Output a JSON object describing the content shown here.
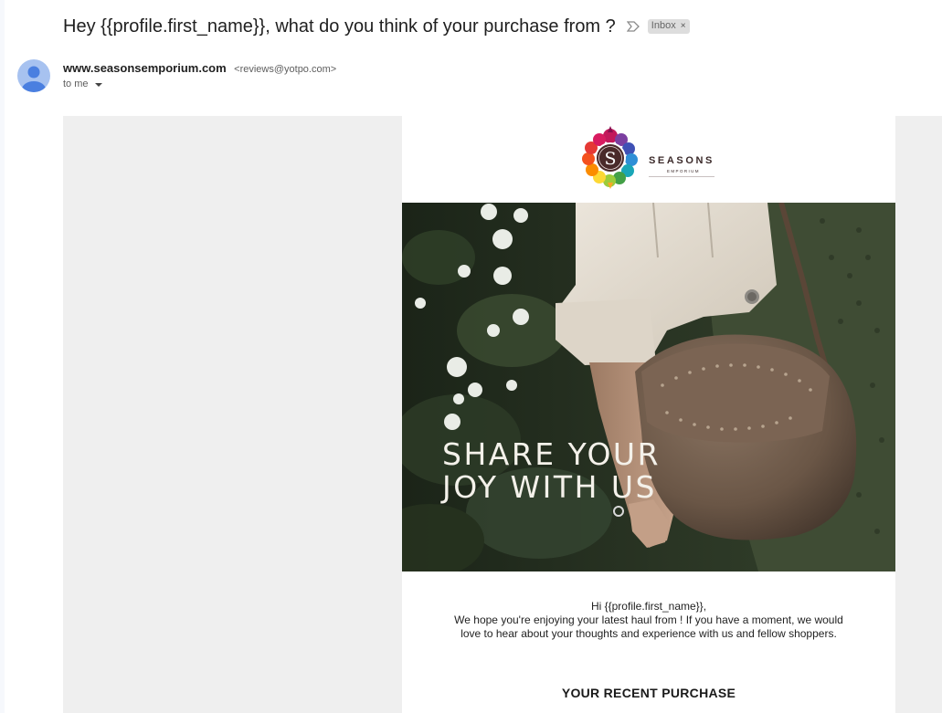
{
  "email": {
    "subject": "Hey {{profile.first_name}}, what do you think of your purchase from ?",
    "label": "Inbox",
    "label_remove": "×",
    "sender_name": "www.seasonsemporium.com",
    "sender_email": "<reviews@yotpo.com>",
    "recipient": "to me"
  },
  "brand": {
    "name": "SEASONS",
    "tagline": "EMPORIUM"
  },
  "hero": {
    "line1": "SHARE YOUR",
    "line2": "JOY WITH US"
  },
  "body": {
    "greeting": "Hi {{profile.first_name}},",
    "message": "We hope you're enjoying your latest haul from ! If you have a moment, we would love to hear about your thoughts and experience with us and fellow shoppers.",
    "section_title": "YOUR RECENT PURCHASE"
  },
  "icons": {
    "important": "importance-marker-icon",
    "avatar": "default-avatar-icon",
    "dropdown": "caret-down-icon"
  },
  "colors": {
    "avatar_bg": "#a7c2f0",
    "avatar_fg": "#4a7fe0",
    "email_bg": "#efefef",
    "hero_text": "#f4f1ea"
  }
}
